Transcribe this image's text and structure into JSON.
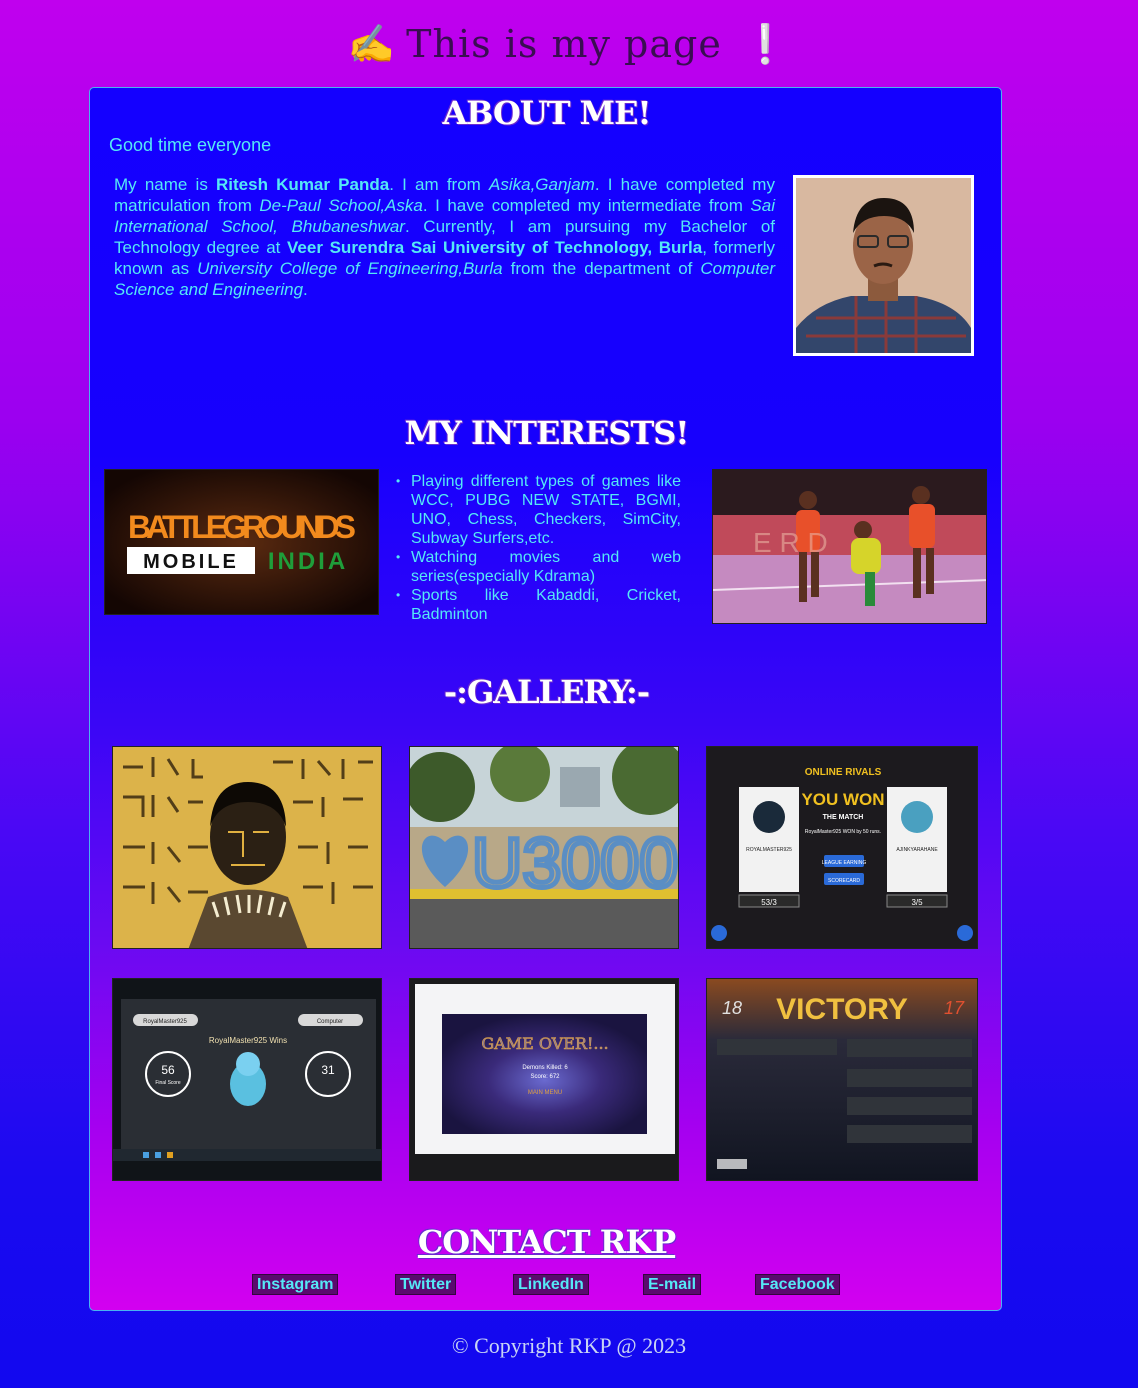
{
  "header": {
    "emoji": "✍️",
    "title": "This is my page",
    "exclaim": "❕"
  },
  "about": {
    "heading": "ABOUT ME!",
    "greeting": "Good time everyone",
    "p1": "My name is ",
    "name": "Ritesh Kumar Panda",
    "p2": ". I am from ",
    "hometown": "Asika,Ganjam",
    "p3": ". I have completed my matriculation from ",
    "school": "De-Paul School,Aska",
    "p4": ". I have completed my intermediate from ",
    "college": "Sai International School, Bhubaneshwar",
    "p5": ". Currently, I am pursuing my Bachelor of Technology degree at ",
    "university": "Veer Surendra Sai University of Technology, Burla",
    "p6": ", formerly known as ",
    "former": "University College of Engineering,Burla",
    "p7": " from the department of ",
    "department": "Computer Science and Engineering",
    "p8": "."
  },
  "interests": {
    "heading": "MY INTERESTS!",
    "items": [
      "Playing different types of games like WCC, PUBG NEW STATE, BGMI, UNO, Chess, Checkers, SimCity, Subway Surfers,etc.",
      "Watching movies and web series(especially Kdrama)",
      "Sports like Kabaddi, Cricket, Badminton"
    ],
    "bgmi": {
      "line1": "BATTLEGROUNDS",
      "line2a": "MOBILE",
      "line2b": "INDIA"
    }
  },
  "gallery": {
    "heading": "-:GALLERY:-",
    "u3000_text": "U3000",
    "ludo": {
      "title": "ONLINE RIVALS",
      "won": "YOU WON",
      "match": "THE MATCH",
      "detail": "RoyalMaster925 WON by 50 runs.",
      "btn1": "LEAGUE EARNING",
      "btn2": "SCORECARD",
      "left_player": "ROYALMASTER925",
      "left_score": "53/3",
      "right_player": "AJINKYARAHANE",
      "right_score": "3/5"
    },
    "pokemon": {
      "left": "RoyalMaster925",
      "right": "Computer",
      "wins": "RoyalMaster925 Wins",
      "score_left": "56",
      "score_right": "31",
      "label": "Final Score"
    },
    "gameover": {
      "title": "GAME OVER!...",
      "line1": "Demons Killed: 6",
      "line2": "Score: 672",
      "menu": "MAIN MENU"
    },
    "victory": {
      "title": "VICTORY",
      "left": "18",
      "right": "17"
    }
  },
  "contact": {
    "heading": "CONTACT RKP",
    "links": [
      "Instagram",
      "Twitter",
      "LinkedIn",
      "E-mail",
      "Facebook"
    ]
  },
  "footer": {
    "text": "© Copyright RKP @ 2023"
  },
  "colors": {
    "accent_text": "#55e8f6",
    "title_text": "#3a0d52",
    "link_bg": "#5a0a6e"
  }
}
